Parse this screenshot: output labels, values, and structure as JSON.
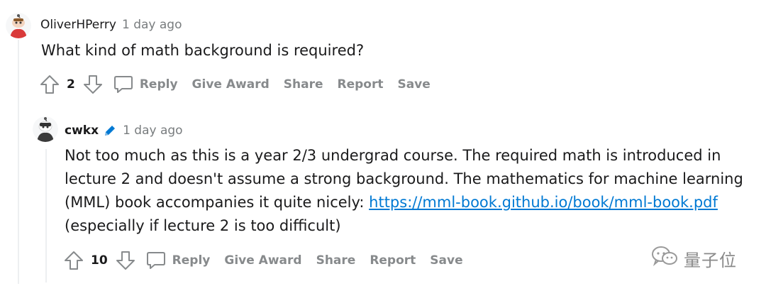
{
  "comments": [
    {
      "username": "OliverHPerry",
      "timestamp": "1 day ago",
      "body": "What kind of math background is required?",
      "score": "2",
      "actions": {
        "reply": "Reply",
        "give_award": "Give Award",
        "share": "Share",
        "report": "Report",
        "save": "Save"
      }
    },
    {
      "username": "cwkx",
      "timestamp": "1 day ago",
      "body_before_link": "Not too much as this is a year 2/3 undergrad course. The required math is introduced in lecture 2 and doesn't assume a strong background. The mathematics for machine learning (MML) book accompanies it quite nicely: ",
      "link_text": "https://mml-book.github.io/book/mml-book.pdf",
      "body_after_link": "(especially if lecture 2 is too difficult)",
      "score": "10",
      "actions": {
        "reply": "Reply",
        "give_award": "Give Award",
        "share": "Share",
        "report": "Report",
        "save": "Save"
      }
    }
  ],
  "icons": {
    "upvote": "arrow-up-icon",
    "downvote": "arrow-down-icon",
    "reply": "speech-bubble-icon",
    "edit": "pencil-icon"
  },
  "watermark": {
    "text": "量子位"
  },
  "colors": {
    "link": "#0079d3",
    "action_grey": "#878a8c",
    "thread_line": "#edeff1",
    "pencil": "#0079d3"
  }
}
